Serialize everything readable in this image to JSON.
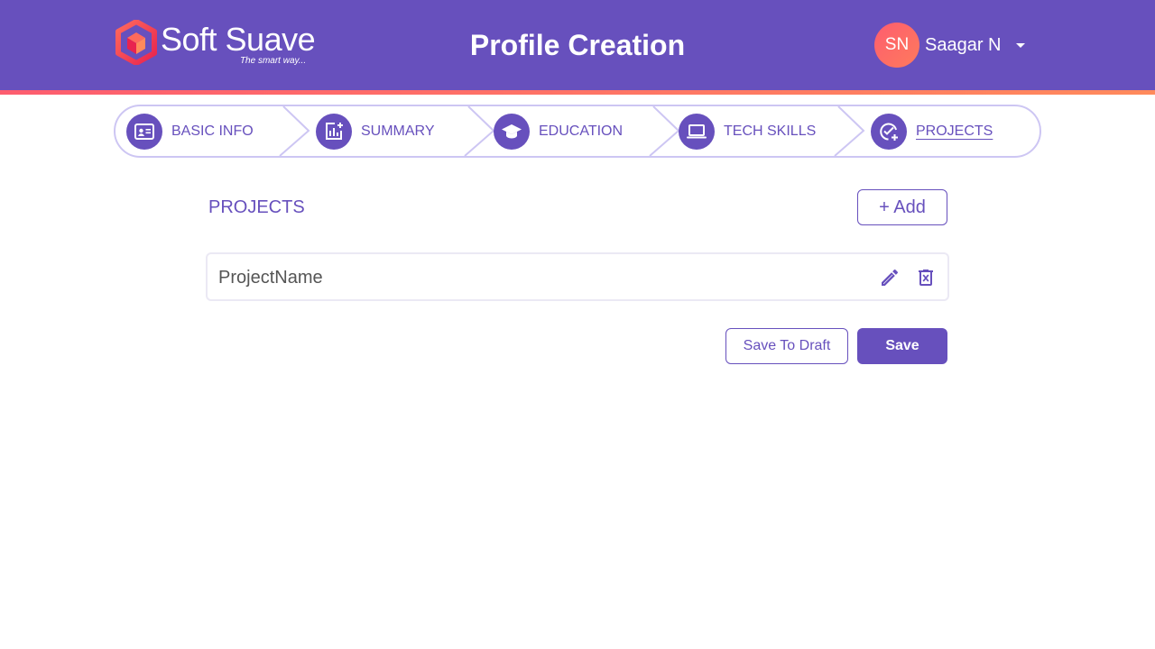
{
  "header": {
    "logo": {
      "name": "Soft Suave",
      "tagline": "The smart way..."
    },
    "title": "Profile Creation",
    "user": {
      "initials": "SN",
      "name": "Saagar N"
    }
  },
  "stepper": {
    "steps": [
      {
        "label": "BASIC INFO",
        "icon": "id-card-icon"
      },
      {
        "label": "SUMMARY",
        "icon": "chart-add-icon"
      },
      {
        "label": "EDUCATION",
        "icon": "graduation-cap-icon"
      },
      {
        "label": "TECH SKILLS",
        "icon": "laptop-icon"
      },
      {
        "label": "PROJECTS",
        "icon": "check-plus-icon",
        "active": true
      }
    ]
  },
  "main": {
    "section_title": "PROJECTS",
    "add_label": "+ Add",
    "projects": [
      {
        "name": "ProjectName"
      }
    ],
    "save_draft_label": "Save To Draft",
    "save_label": "Save"
  },
  "colors": {
    "primary": "#6750bd",
    "accent": "#fd5d6f",
    "stepper_border": "#cdc6f3"
  }
}
